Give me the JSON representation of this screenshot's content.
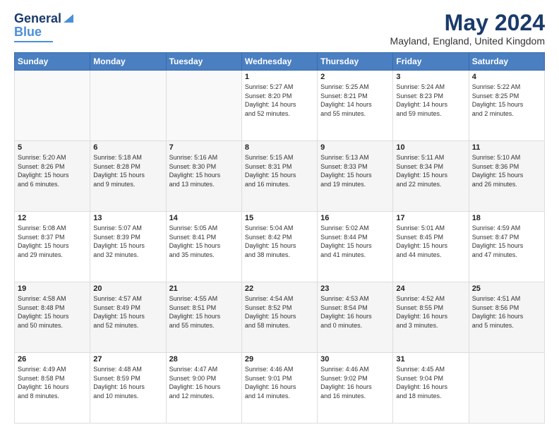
{
  "header": {
    "logo_general": "General",
    "logo_blue": "Blue",
    "month_title": "May 2024",
    "location": "Mayland, England, United Kingdom"
  },
  "days_of_week": [
    "Sunday",
    "Monday",
    "Tuesday",
    "Wednesday",
    "Thursday",
    "Friday",
    "Saturday"
  ],
  "weeks": [
    [
      {
        "day": "",
        "info": ""
      },
      {
        "day": "",
        "info": ""
      },
      {
        "day": "",
        "info": ""
      },
      {
        "day": "1",
        "info": "Sunrise: 5:27 AM\nSunset: 8:20 PM\nDaylight: 14 hours\nand 52 minutes."
      },
      {
        "day": "2",
        "info": "Sunrise: 5:25 AM\nSunset: 8:21 PM\nDaylight: 14 hours\nand 55 minutes."
      },
      {
        "day": "3",
        "info": "Sunrise: 5:24 AM\nSunset: 8:23 PM\nDaylight: 14 hours\nand 59 minutes."
      },
      {
        "day": "4",
        "info": "Sunrise: 5:22 AM\nSunset: 8:25 PM\nDaylight: 15 hours\nand 2 minutes."
      }
    ],
    [
      {
        "day": "5",
        "info": "Sunrise: 5:20 AM\nSunset: 8:26 PM\nDaylight: 15 hours\nand 6 minutes."
      },
      {
        "day": "6",
        "info": "Sunrise: 5:18 AM\nSunset: 8:28 PM\nDaylight: 15 hours\nand 9 minutes."
      },
      {
        "day": "7",
        "info": "Sunrise: 5:16 AM\nSunset: 8:30 PM\nDaylight: 15 hours\nand 13 minutes."
      },
      {
        "day": "8",
        "info": "Sunrise: 5:15 AM\nSunset: 8:31 PM\nDaylight: 15 hours\nand 16 minutes."
      },
      {
        "day": "9",
        "info": "Sunrise: 5:13 AM\nSunset: 8:33 PM\nDaylight: 15 hours\nand 19 minutes."
      },
      {
        "day": "10",
        "info": "Sunrise: 5:11 AM\nSunset: 8:34 PM\nDaylight: 15 hours\nand 22 minutes."
      },
      {
        "day": "11",
        "info": "Sunrise: 5:10 AM\nSunset: 8:36 PM\nDaylight: 15 hours\nand 26 minutes."
      }
    ],
    [
      {
        "day": "12",
        "info": "Sunrise: 5:08 AM\nSunset: 8:37 PM\nDaylight: 15 hours\nand 29 minutes."
      },
      {
        "day": "13",
        "info": "Sunrise: 5:07 AM\nSunset: 8:39 PM\nDaylight: 15 hours\nand 32 minutes."
      },
      {
        "day": "14",
        "info": "Sunrise: 5:05 AM\nSunset: 8:41 PM\nDaylight: 15 hours\nand 35 minutes."
      },
      {
        "day": "15",
        "info": "Sunrise: 5:04 AM\nSunset: 8:42 PM\nDaylight: 15 hours\nand 38 minutes."
      },
      {
        "day": "16",
        "info": "Sunrise: 5:02 AM\nSunset: 8:44 PM\nDaylight: 15 hours\nand 41 minutes."
      },
      {
        "day": "17",
        "info": "Sunrise: 5:01 AM\nSunset: 8:45 PM\nDaylight: 15 hours\nand 44 minutes."
      },
      {
        "day": "18",
        "info": "Sunrise: 4:59 AM\nSunset: 8:47 PM\nDaylight: 15 hours\nand 47 minutes."
      }
    ],
    [
      {
        "day": "19",
        "info": "Sunrise: 4:58 AM\nSunset: 8:48 PM\nDaylight: 15 hours\nand 50 minutes."
      },
      {
        "day": "20",
        "info": "Sunrise: 4:57 AM\nSunset: 8:49 PM\nDaylight: 15 hours\nand 52 minutes."
      },
      {
        "day": "21",
        "info": "Sunrise: 4:55 AM\nSunset: 8:51 PM\nDaylight: 15 hours\nand 55 minutes."
      },
      {
        "day": "22",
        "info": "Sunrise: 4:54 AM\nSunset: 8:52 PM\nDaylight: 15 hours\nand 58 minutes."
      },
      {
        "day": "23",
        "info": "Sunrise: 4:53 AM\nSunset: 8:54 PM\nDaylight: 16 hours\nand 0 minutes."
      },
      {
        "day": "24",
        "info": "Sunrise: 4:52 AM\nSunset: 8:55 PM\nDaylight: 16 hours\nand 3 minutes."
      },
      {
        "day": "25",
        "info": "Sunrise: 4:51 AM\nSunset: 8:56 PM\nDaylight: 16 hours\nand 5 minutes."
      }
    ],
    [
      {
        "day": "26",
        "info": "Sunrise: 4:49 AM\nSunset: 8:58 PM\nDaylight: 16 hours\nand 8 minutes."
      },
      {
        "day": "27",
        "info": "Sunrise: 4:48 AM\nSunset: 8:59 PM\nDaylight: 16 hours\nand 10 minutes."
      },
      {
        "day": "28",
        "info": "Sunrise: 4:47 AM\nSunset: 9:00 PM\nDaylight: 16 hours\nand 12 minutes."
      },
      {
        "day": "29",
        "info": "Sunrise: 4:46 AM\nSunset: 9:01 PM\nDaylight: 16 hours\nand 14 minutes."
      },
      {
        "day": "30",
        "info": "Sunrise: 4:46 AM\nSunset: 9:02 PM\nDaylight: 16 hours\nand 16 minutes."
      },
      {
        "day": "31",
        "info": "Sunrise: 4:45 AM\nSunset: 9:04 PM\nDaylight: 16 hours\nand 18 minutes."
      },
      {
        "day": "",
        "info": ""
      }
    ]
  ]
}
